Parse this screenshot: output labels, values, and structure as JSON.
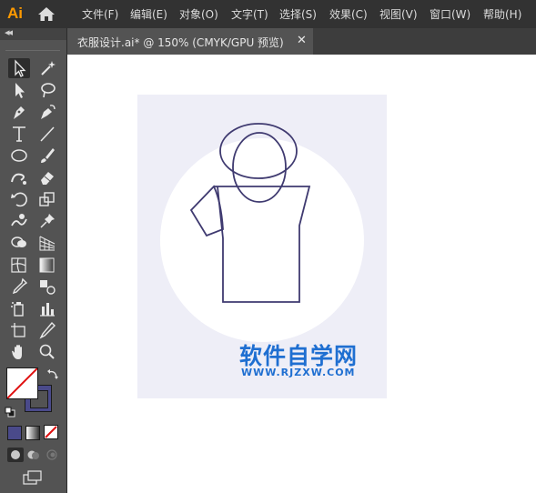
{
  "app": {
    "logo_text": "Ai",
    "accent": "#ff9a00"
  },
  "menu": {
    "items": [
      {
        "label": "文件(F)"
      },
      {
        "label": "编辑(E)"
      },
      {
        "label": "对象(O)"
      },
      {
        "label": "文字(T)"
      },
      {
        "label": "选择(S)"
      },
      {
        "label": "效果(C)"
      },
      {
        "label": "视图(V)"
      },
      {
        "label": "窗口(W)"
      },
      {
        "label": "帮助(H)"
      }
    ]
  },
  "document": {
    "tab_title": "衣服设计.ai* @ 150% (CMYK/GPU 预览)",
    "close_glyph": "✕",
    "artboard_color": "#eeeef7",
    "circle_color": "#ffffff",
    "stroke_color": "#3f3a70"
  },
  "tools_panel": {
    "collapse_glyph": "◂◂",
    "tools": [
      "selection-tool",
      "magic-wand-tool",
      "direct-selection-tool",
      "lasso-tool",
      "pen-tool",
      "curvature-tool",
      "type-tool",
      "line-segment-tool",
      "ellipse-tool",
      "paintbrush-tool",
      "shaper-tool",
      "eraser-tool",
      "rotate-tool",
      "scale-tool",
      "warp-tool",
      "pin-tool",
      "shape-builder-tool",
      "perspective-grid-tool",
      "mesh-tool",
      "gradient-tool",
      "eyedropper-tool",
      "blend-tool",
      "symbol-sprayer-tool",
      "column-graph-tool",
      "artboard-tool",
      "slice-tool",
      "hand-tool",
      "zoom-tool"
    ],
    "fill_color": "#ffffff",
    "stroke_color": "#4a4a8a",
    "no_color": "#e01010"
  },
  "watermark": {
    "title": "软件自学网",
    "url": "WWW.RJZXW.COM",
    "color": "#1f6fd1"
  }
}
